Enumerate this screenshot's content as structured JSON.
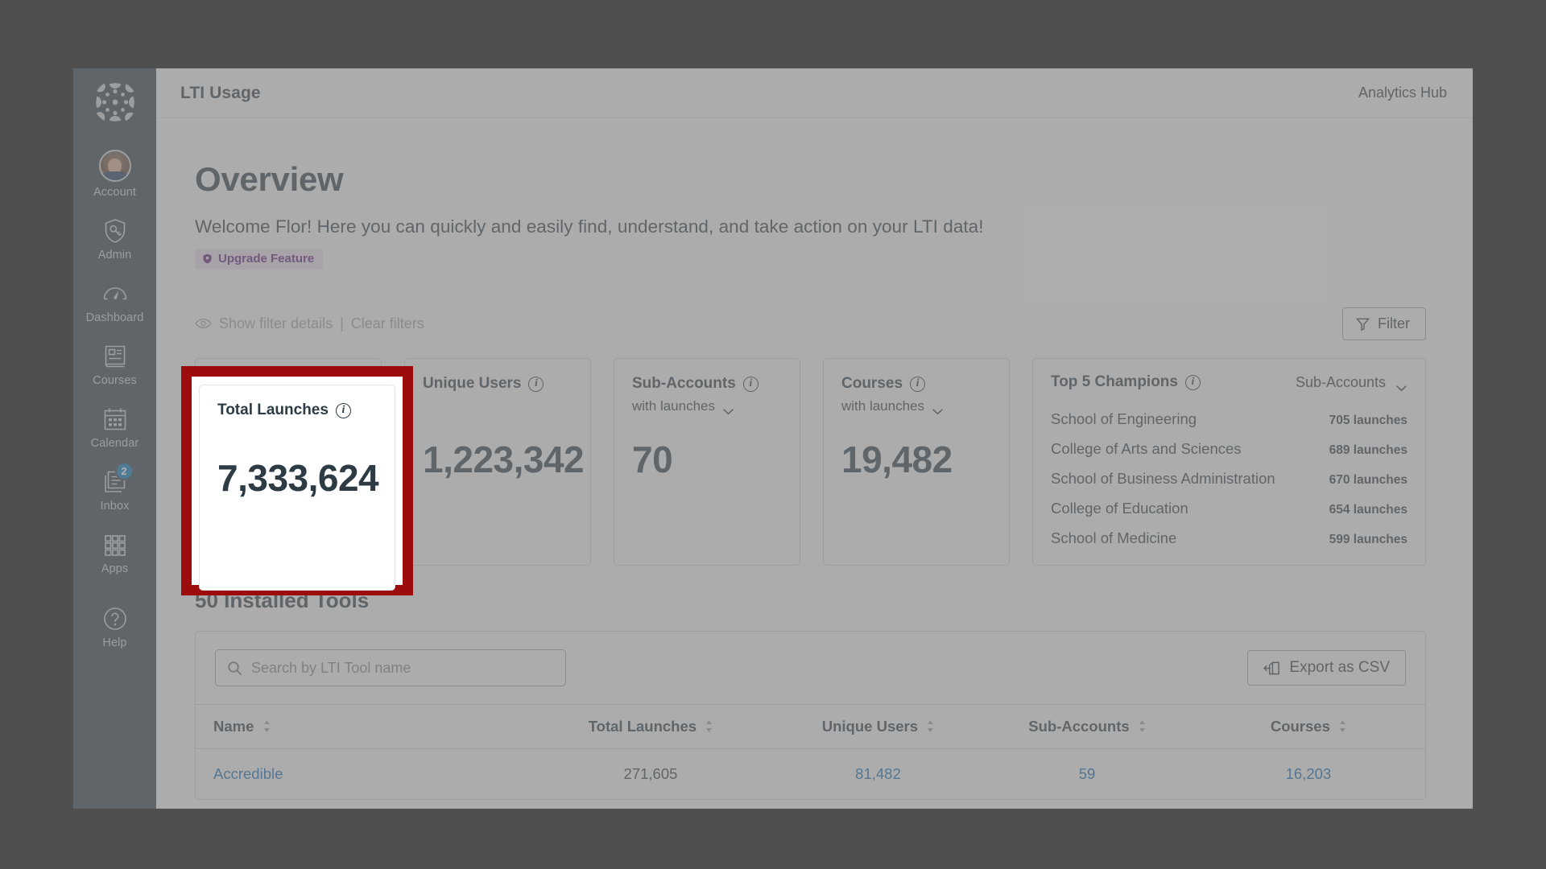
{
  "sidebar": {
    "logo": "canvas-logo",
    "items": [
      {
        "label": "Account",
        "icon": "avatar"
      },
      {
        "label": "Admin",
        "icon": "shield-key-icon"
      },
      {
        "label": "Dashboard",
        "icon": "gauge-icon"
      },
      {
        "label": "Courses",
        "icon": "book-icon"
      },
      {
        "label": "Calendar",
        "icon": "calendar-icon"
      },
      {
        "label": "Inbox",
        "icon": "inbox-icon",
        "badge": "2"
      },
      {
        "label": "Apps",
        "icon": "grid-icon"
      },
      {
        "label": "Help",
        "icon": "question-circle-icon"
      }
    ]
  },
  "topbar": {
    "title": "LTI Usage",
    "right_label": "Analytics Hub"
  },
  "overview": {
    "title": "Overview",
    "welcome": "Welcome Flor! Here you can quickly and easily find, understand, and take action on your LTI data!",
    "upgrade_pill": "Upgrade Feature",
    "upgrade_pill_icon": "shield-badge-icon",
    "upgrade_pill_color": "#5c1c75",
    "upgrade_pill_bg": "#e6dced"
  },
  "filters": {
    "eye_icon": "eye-icon",
    "show_details": "Show filter details",
    "separator": "|",
    "clear": "Clear filters",
    "filter_button": "Filter",
    "filter_icon": "funnel-icon"
  },
  "cards": [
    {
      "title": "Total Launches",
      "subtitle": null,
      "value": "7,333,624",
      "info_icon": "info-icon",
      "highlighted": true
    },
    {
      "title": "Unique Users",
      "subtitle": null,
      "value": "1,223,342",
      "info_icon": "info-icon",
      "highlighted": false
    },
    {
      "title": "Sub-Accounts",
      "subtitle": "with launches",
      "value": "70",
      "info_icon": "info-icon",
      "highlighted": false
    },
    {
      "title": "Courses",
      "subtitle": "with launches",
      "value": "19,482",
      "info_icon": "info-icon",
      "highlighted": false
    }
  ],
  "champions": {
    "title": "Top 5 Champions",
    "info_icon": "info-icon",
    "selector_value": "Sub-Accounts",
    "selector_icon": "chevron-down-icon",
    "rows": [
      {
        "name": "School of Engineering",
        "value": "705 launches"
      },
      {
        "name": "College of Arts and Sciences",
        "value": "689 launches"
      },
      {
        "name": "School of Business Administration",
        "value": "670 launches"
      },
      {
        "name": "College of Education",
        "value": "654 launches"
      },
      {
        "name": "School of Medicine",
        "value": "599 launches"
      }
    ]
  },
  "tools": {
    "heading": "50 Installed Tools",
    "search_placeholder": "Search by LTI Tool name",
    "search_value": "",
    "search_icon": "search-icon",
    "export_label": "Export as CSV",
    "export_icon": "export-icon",
    "columns": [
      "Name",
      "Total Launches",
      "Unique Users",
      "Sub-Accounts",
      "Courses"
    ],
    "rows": [
      {
        "name": "Accredible",
        "total_launches": "271,605",
        "unique_users": "81,482",
        "sub_accounts": "59",
        "courses": "16,203"
      }
    ]
  },
  "annotation": {
    "type": "highlight-box",
    "target": "Total Launches card",
    "color": "#9c0c0c"
  }
}
